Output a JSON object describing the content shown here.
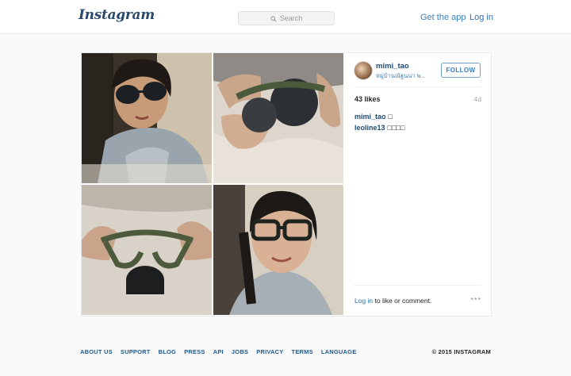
{
  "header": {
    "logo_text": "Instagram",
    "search_placeholder": "Search",
    "get_app": "Get the app",
    "log_in": "Log in"
  },
  "post": {
    "username": "mimi_tao",
    "location": "หมู่บ้านณัฐนนา พ...",
    "follow_label": "FOLLOW",
    "likes": "43 likes",
    "age": "4d",
    "comments": [
      {
        "user": "mimi_tao",
        "text": "□"
      },
      {
        "user": "leoline13",
        "text": "□□□□"
      }
    ],
    "login_prompt_link": "Log in",
    "login_prompt_rest": " to like or comment.",
    "more_label": "•••"
  },
  "footer": {
    "links": [
      "ABOUT US",
      "SUPPORT",
      "BLOG",
      "PRESS",
      "API",
      "JOBS",
      "PRIVACY",
      "TERMS",
      "LANGUAGE"
    ],
    "copyright": "© 2015 INSTAGRAM"
  },
  "colors": {
    "link_blue": "#3a80c0",
    "username_blue": "#1f4b78",
    "background": "#fafafa"
  }
}
